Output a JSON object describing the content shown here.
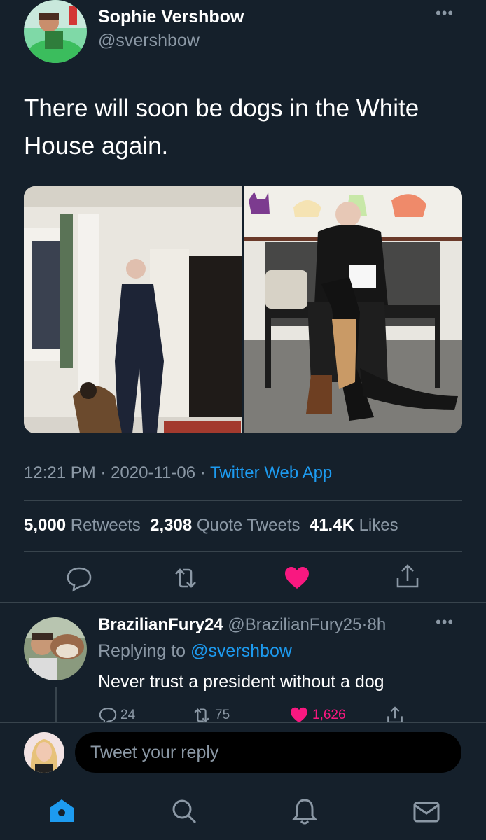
{
  "tweet": {
    "author_name": "Sophie Vershbow",
    "author_handle": "@svershbow",
    "text": "There will soon be dogs in the White House again.",
    "time": "12:21 PM",
    "date": "2020-11-06",
    "source": "Twitter Web App",
    "separator": "·",
    "stats": {
      "retweets_count": "5,000",
      "retweets_label": "Retweets",
      "quotes_count": "2,308",
      "quotes_label": "Quote Tweets",
      "likes_count": "41.4K",
      "likes_label": "Likes"
    }
  },
  "reply": {
    "author_name": "BrazilianFury24",
    "author_handle": "@BrazilianFury25",
    "age": "8h",
    "replying_prefix": "Replying to",
    "replying_to": "@svershbow",
    "text": "Never trust a president without a dog",
    "replies": "24",
    "retweets": "75",
    "likes": "1,626"
  },
  "compose": {
    "placeholder": "Tweet your reply"
  },
  "colors": {
    "background": "#15202b",
    "accent": "#1d9bf0",
    "like": "#f91880",
    "muted": "#8b98a5"
  },
  "icons": [
    "more-icon",
    "reply-icon",
    "retweet-icon",
    "heart-icon",
    "share-icon",
    "home-icon",
    "search-icon",
    "bell-icon",
    "mail-icon"
  ]
}
